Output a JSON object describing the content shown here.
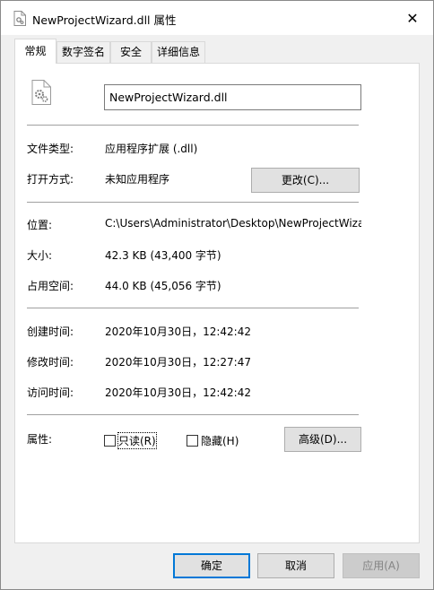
{
  "window": {
    "title": "NewProjectWizard.dll 属性",
    "close_glyph": "✕"
  },
  "tabs": [
    {
      "label": "常规",
      "active": true
    },
    {
      "label": "数字签名",
      "active": false
    },
    {
      "label": "安全",
      "active": false
    },
    {
      "label": "详细信息",
      "active": false
    }
  ],
  "general": {
    "file_name": "NewProjectWizard.dll",
    "rows": {
      "type": {
        "label": "文件类型:",
        "value": "应用程序扩展 (.dll)"
      },
      "opens_with": {
        "label": "打开方式:",
        "value": "未知应用程序",
        "change_button": "更改(C)..."
      },
      "location": {
        "label": "位置:",
        "value": "C:\\Users\\Administrator\\Desktop\\NewProjectWizard"
      },
      "size": {
        "label": "大小:",
        "value": "42.3 KB (43,400 字节)"
      },
      "size_on_disk": {
        "label": "占用空间:",
        "value": "44.0 KB (45,056 字节)"
      },
      "created": {
        "label": "创建时间:",
        "value": "2020年10月30日，12:42:42"
      },
      "modified": {
        "label": "修改时间:",
        "value": "2020年10月30日，12:27:47"
      },
      "accessed": {
        "label": "访问时间:",
        "value": "2020年10月30日，12:42:42"
      }
    },
    "attributes": {
      "label": "属性:",
      "readonly": {
        "label": "只读(R)",
        "checked": false
      },
      "hidden": {
        "label": "隐藏(H)",
        "checked": false
      },
      "advanced_button": "高级(D)..."
    }
  },
  "footer": {
    "ok": "确定",
    "cancel": "取消",
    "apply": "应用(A)"
  },
  "colors": {
    "accent": "#0078d7",
    "panel_bg": "#ffffff",
    "dialog_bg": "#f0f0f0"
  }
}
